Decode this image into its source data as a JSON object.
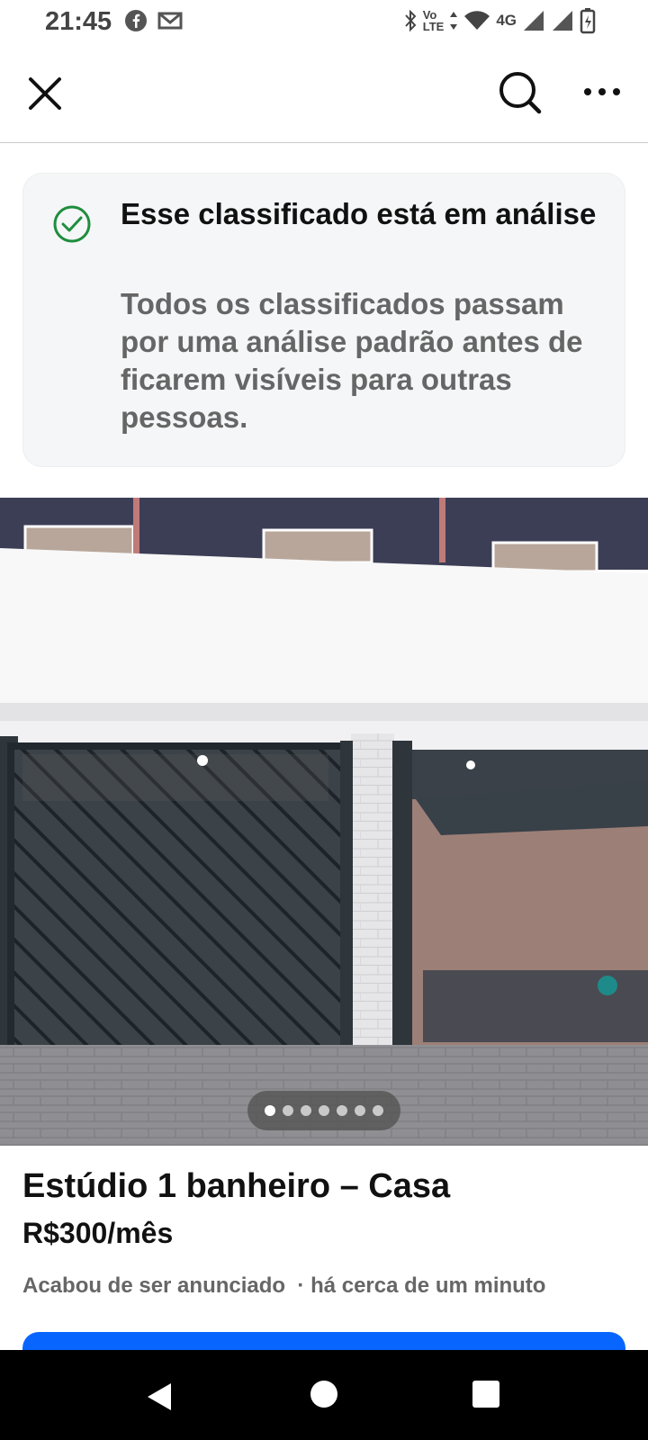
{
  "status_bar": {
    "time": "21:45",
    "network": "4G",
    "volte_top": "Vo",
    "volte_bottom": "LTE"
  },
  "app_bar": {
    "close_icon": "close-icon",
    "search_icon": "search-icon",
    "more_icon": "more-icon"
  },
  "notice": {
    "icon": "check-circle-icon",
    "title": "Esse classificado está em análise",
    "body": "Todos os classificados passam por uma análise padrão antes de ficarem visíveis para outras pessoas."
  },
  "photo": {
    "count": 7,
    "active_index": 0
  },
  "listing": {
    "title": "Estúdio 1 banheiro – Casa",
    "price": "R$300/mês",
    "meta": "Acabou de ser anunciado  · há cerca de um minuto"
  },
  "colors": {
    "accent": "#0866ff",
    "success": "#1e8e3e"
  }
}
